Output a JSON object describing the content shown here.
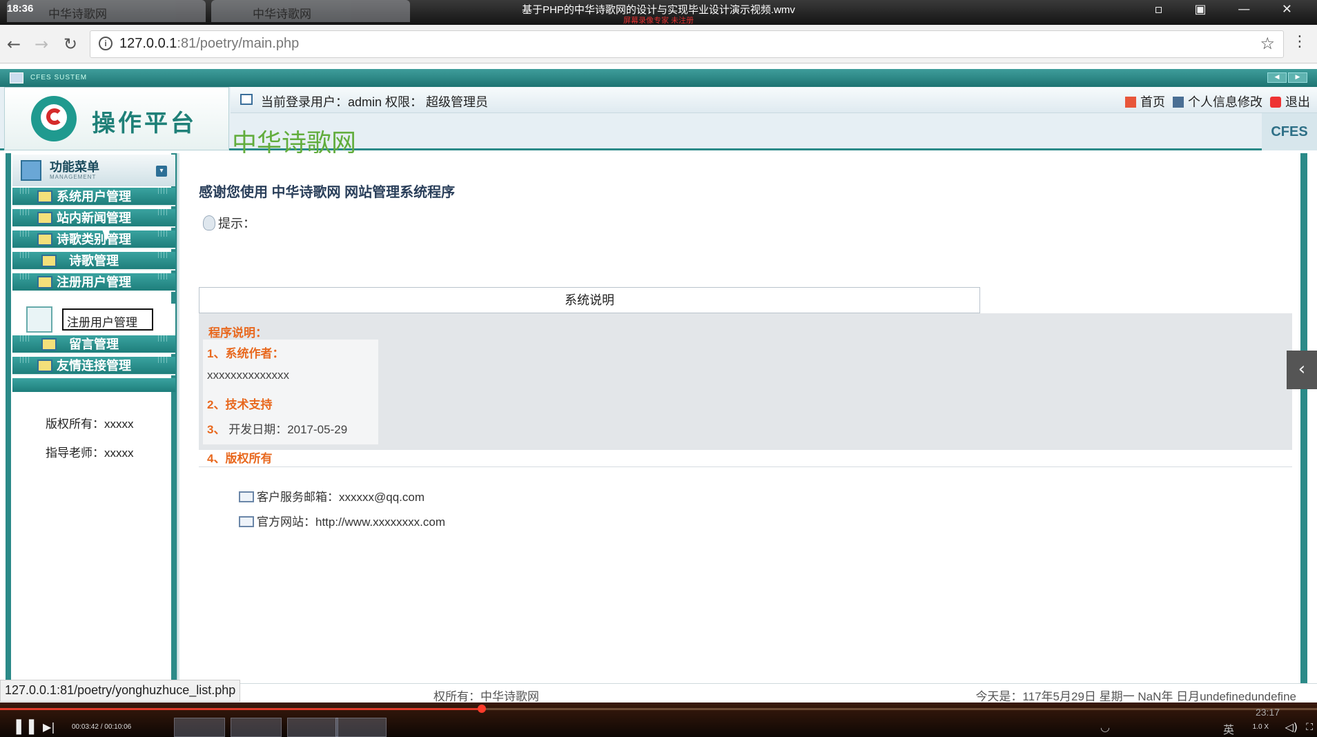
{
  "player": {
    "clock": "18:36",
    "title": "基于PHP的中华诗歌网的设计与实现毕业设计演示视频.wmv",
    "watermark": "屏幕录像专家 未注册",
    "time": "00:03:42 / 00:10:06",
    "speed": "1.0 X",
    "overlay_time": "23:17",
    "progress_fraction": 0.366
  },
  "browser": {
    "tabs": [
      "中华诗歌网",
      "中华诗歌网"
    ],
    "url_host": "127.0.0.1",
    "url_rest": ":81/poetry/main.php",
    "status_url": "127.0.0.1:81/poetry/yonghuzhuce_list.php"
  },
  "header": {
    "logo_text": "操作平台",
    "system_label": "CFES SUSTEM",
    "user_label": "当前登录用户：admin 权限： 超级管理员",
    "site_name": "中华诗歌网",
    "cfes": "CFES",
    "links": {
      "home": "首页",
      "profile": "个人信息修改",
      "logout": "退出"
    }
  },
  "sidebar": {
    "title": "功能菜单",
    "subtitle": "MANAGEMENT",
    "items": [
      {
        "label": "系统用户管理"
      },
      {
        "label": "站内新闻管理"
      },
      {
        "label": "诗歌类别管理"
      },
      {
        "label": "诗歌管理"
      },
      {
        "label": "注册用户管理"
      },
      {
        "label": "留言管理"
      },
      {
        "label": "友情连接管理"
      }
    ],
    "sub_item": "注册用户管理",
    "copyright": "版权所有：xxxxx",
    "teacher": "指导老师：xxxxx"
  },
  "main": {
    "title": "感谢您使用 中华诗歌网 网站管理系统程序",
    "tip": "提示：",
    "system_box": "系统说明",
    "program_title": "程序说明：",
    "item1": "1、系统作者：",
    "item1_value": "xxxxxxxxxxxxxx",
    "item2": "2、技术支持",
    "item3_num": "3、",
    "item3": " 开发日期：2017-05-29",
    "item4": "4、版权所有",
    "email": "客户服务邮箱：xxxxxx@qq.com",
    "website": "官方网站：http://www.xxxxxxxx.com"
  },
  "footer": {
    "left": "权所有：中华诗歌网",
    "right": "今天是：117年5月29日 星期一 NaN年 日月undefinedundefine"
  }
}
